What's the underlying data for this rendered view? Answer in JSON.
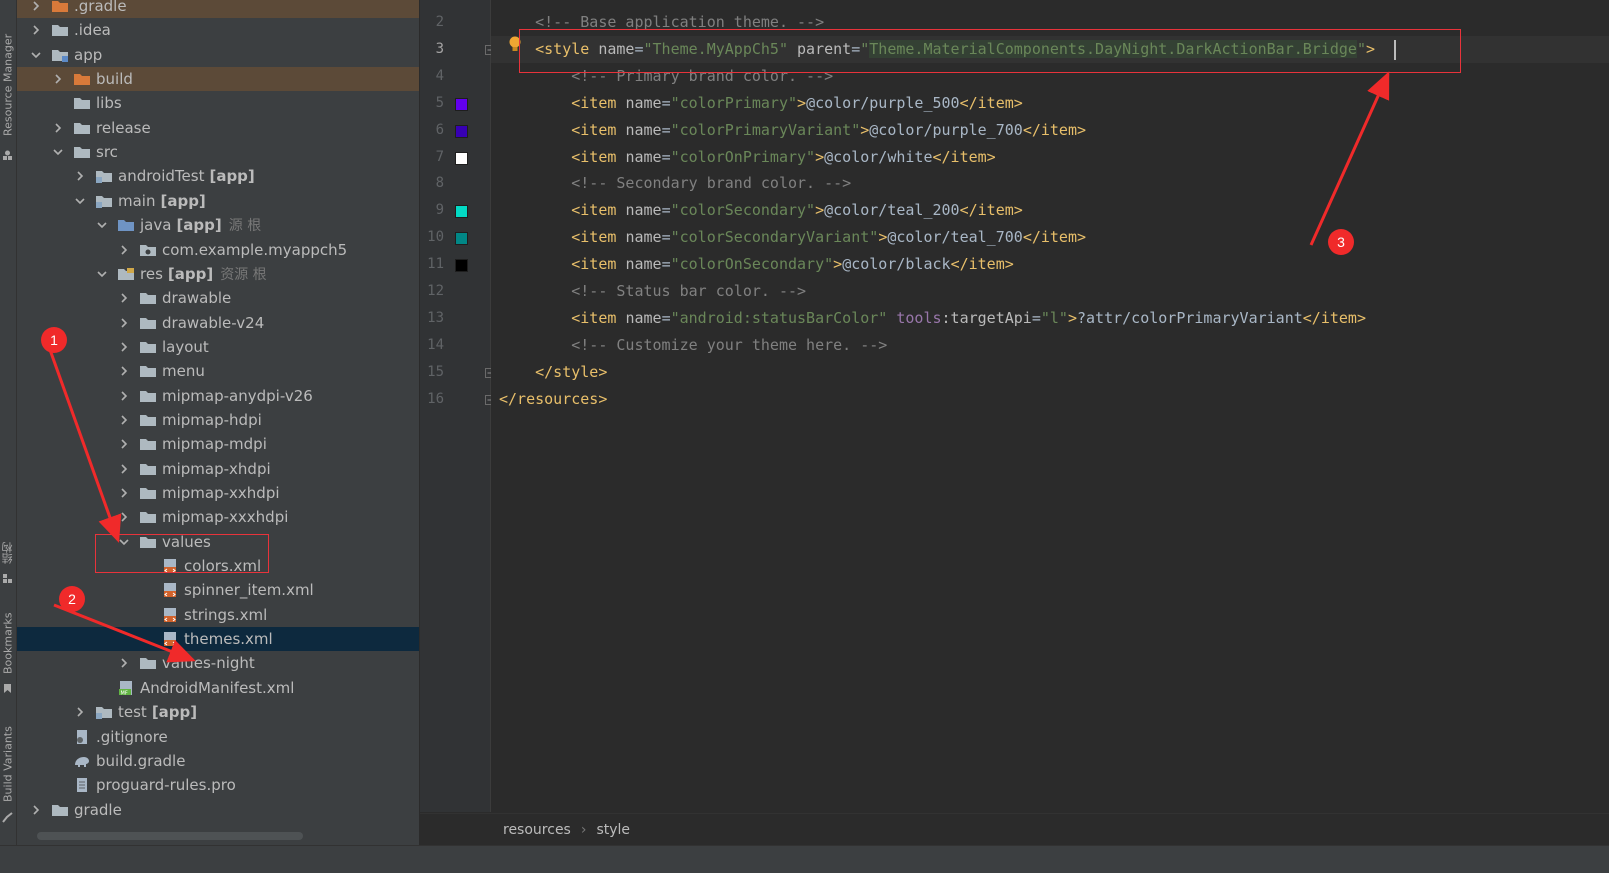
{
  "toolstrip": {
    "resource_manager": "Resource Manager",
    "structure": "结构",
    "bookmarks": "Bookmarks",
    "build_variants": "Build Variants"
  },
  "tree": [
    {
      "label": ".gradle",
      "suffix": "",
      "hint": "",
      "icon": "folder-orange-icon",
      "chevron": "right"
    },
    {
      "label": ".idea",
      "suffix": "",
      "hint": "",
      "icon": "folder-icon",
      "chevron": "right"
    },
    {
      "label": "app",
      "suffix": "",
      "hint": "",
      "icon": "module-folder-icon",
      "chevron": "down"
    },
    {
      "label": "build",
      "suffix": "",
      "hint": "",
      "icon": "folder-orange-icon",
      "chevron": "right"
    },
    {
      "label": "libs",
      "suffix": "",
      "hint": "",
      "icon": "folder-icon",
      "chevron": "none"
    },
    {
      "label": "release",
      "suffix": "",
      "hint": "",
      "icon": "folder-icon",
      "chevron": "right"
    },
    {
      "label": "src",
      "suffix": "",
      "hint": "",
      "icon": "folder-icon",
      "chevron": "down"
    },
    {
      "label": "androidTest",
      "suffix": "[app]",
      "hint": "",
      "icon": "source-folder-icon",
      "chevron": "right"
    },
    {
      "label": "main",
      "suffix": "[app]",
      "hint": "",
      "icon": "source-folder-icon",
      "chevron": "down"
    },
    {
      "label": "java",
      "suffix": "[app]",
      "hint": "源 根",
      "icon": "java-folder-icon",
      "chevron": "down"
    },
    {
      "label": "com.example.myappch5",
      "suffix": "",
      "hint": "",
      "icon": "package-icon",
      "chevron": "right"
    },
    {
      "label": "res",
      "suffix": "[app]",
      "hint": "资源 根",
      "icon": "res-folder-icon",
      "chevron": "down"
    },
    {
      "label": "drawable",
      "suffix": "",
      "hint": "",
      "icon": "folder-icon",
      "chevron": "right"
    },
    {
      "label": "drawable-v24",
      "suffix": "",
      "hint": "",
      "icon": "folder-icon",
      "chevron": "right"
    },
    {
      "label": "layout",
      "suffix": "",
      "hint": "",
      "icon": "folder-icon",
      "chevron": "right"
    },
    {
      "label": "menu",
      "suffix": "",
      "hint": "",
      "icon": "folder-icon",
      "chevron": "right"
    },
    {
      "label": "mipmap-anydpi-v26",
      "suffix": "",
      "hint": "",
      "icon": "folder-icon",
      "chevron": "right"
    },
    {
      "label": "mipmap-hdpi",
      "suffix": "",
      "hint": "",
      "icon": "folder-icon",
      "chevron": "right"
    },
    {
      "label": "mipmap-mdpi",
      "suffix": "",
      "hint": "",
      "icon": "folder-icon",
      "chevron": "right"
    },
    {
      "label": "mipmap-xhdpi",
      "suffix": "",
      "hint": "",
      "icon": "folder-icon",
      "chevron": "right"
    },
    {
      "label": "mipmap-xxhdpi",
      "suffix": "",
      "hint": "",
      "icon": "folder-icon",
      "chevron": "right"
    },
    {
      "label": "mipmap-xxxhdpi",
      "suffix": "",
      "hint": "",
      "icon": "folder-icon",
      "chevron": "right"
    },
    {
      "label": "values",
      "suffix": "",
      "hint": "",
      "icon": "folder-icon",
      "chevron": "down"
    },
    {
      "label": "colors.xml",
      "suffix": "",
      "hint": "",
      "icon": "xml-file-icon",
      "chevron": "none"
    },
    {
      "label": "spinner_item.xml",
      "suffix": "",
      "hint": "",
      "icon": "xml-file-icon",
      "chevron": "none"
    },
    {
      "label": "strings.xml",
      "suffix": "",
      "hint": "",
      "icon": "xml-file-icon",
      "chevron": "none"
    },
    {
      "label": "themes.xml",
      "suffix": "",
      "hint": "",
      "icon": "xml-file-icon",
      "chevron": "none"
    },
    {
      "label": "values-night",
      "suffix": "",
      "hint": "",
      "icon": "folder-icon",
      "chevron": "right"
    },
    {
      "label": "AndroidManifest.xml",
      "suffix": "",
      "hint": "",
      "icon": "manifest-file-icon",
      "chevron": "none"
    },
    {
      "label": "test",
      "suffix": "[app]",
      "hint": "",
      "icon": "source-folder-icon",
      "chevron": "right"
    },
    {
      "label": ".gitignore",
      "suffix": "",
      "hint": "",
      "icon": "gitignore-file-icon",
      "chevron": "none"
    },
    {
      "label": "build.gradle",
      "suffix": "",
      "hint": "",
      "icon": "gradle-file-icon",
      "chevron": "none"
    },
    {
      "label": "proguard-rules.pro",
      "suffix": "",
      "hint": "",
      "icon": "text-file-icon",
      "chevron": "none"
    },
    {
      "label": "gradle",
      "suffix": "",
      "hint": "",
      "icon": "folder-icon",
      "chevron": "right"
    }
  ],
  "editor": {
    "line_numbers": [
      "2",
      "3",
      "4",
      "5",
      "6",
      "7",
      "8",
      "9",
      "10",
      "11",
      "12",
      "13",
      "14",
      "15",
      "16"
    ],
    "color_swatches": [
      "#6200ee",
      "#3700b3",
      "#ffffff",
      "#03dac5",
      "#018786",
      "#000000"
    ],
    "lines": [
      [
        [
          "cm",
          "    <!-- Base application theme. -->"
        ]
      ],
      [
        [
          "pln",
          "    "
        ],
        [
          "tg",
          "<style "
        ],
        [
          "at",
          "name"
        ],
        [
          "pln",
          "="
        ],
        [
          "vl",
          "\"Theme.MyAppCh5\""
        ],
        [
          "pln",
          " "
        ],
        [
          "at",
          "parent"
        ],
        [
          "pln",
          "="
        ],
        [
          "vl",
          "\""
        ],
        [
          "vl hlv",
          "Theme.MaterialComponents.DayNight.DarkActionBar.Bridge"
        ],
        [
          "vl",
          "\""
        ],
        [
          "tg",
          ">"
        ]
      ],
      [
        [
          "cm",
          "        <!-- Primary brand color. -->"
        ]
      ],
      [
        [
          "pln",
          "        "
        ],
        [
          "tg",
          "<item "
        ],
        [
          "at",
          "name"
        ],
        [
          "pln",
          "="
        ],
        [
          "vl",
          "\"colorPrimary\""
        ],
        [
          "tg",
          ">"
        ],
        [
          "pln",
          "@color/purple_500"
        ],
        [
          "tg",
          "</item>"
        ]
      ],
      [
        [
          "pln",
          "        "
        ],
        [
          "tg",
          "<item "
        ],
        [
          "at",
          "name"
        ],
        [
          "pln",
          "="
        ],
        [
          "vl",
          "\"colorPrimaryVariant\""
        ],
        [
          "tg",
          ">"
        ],
        [
          "pln",
          "@color/purple_700"
        ],
        [
          "tg",
          "</item>"
        ]
      ],
      [
        [
          "pln",
          "        "
        ],
        [
          "tg",
          "<item "
        ],
        [
          "at",
          "name"
        ],
        [
          "pln",
          "="
        ],
        [
          "vl",
          "\"colorOnPrimary\""
        ],
        [
          "tg",
          ">"
        ],
        [
          "pln",
          "@color/white"
        ],
        [
          "tg",
          "</item>"
        ]
      ],
      [
        [
          "cm",
          "        <!-- Secondary brand color. -->"
        ]
      ],
      [
        [
          "pln",
          "        "
        ],
        [
          "tg",
          "<item "
        ],
        [
          "at",
          "name"
        ],
        [
          "pln",
          "="
        ],
        [
          "vl",
          "\"colorSecondary\""
        ],
        [
          "tg",
          ">"
        ],
        [
          "pln",
          "@color/teal_200"
        ],
        [
          "tg",
          "</item>"
        ]
      ],
      [
        [
          "pln",
          "        "
        ],
        [
          "tg",
          "<item "
        ],
        [
          "at",
          "name"
        ],
        [
          "pln",
          "="
        ],
        [
          "vl",
          "\"colorSecondaryVariant\""
        ],
        [
          "tg",
          ">"
        ],
        [
          "pln",
          "@color/teal_700"
        ],
        [
          "tg",
          "</item>"
        ]
      ],
      [
        [
          "pln",
          "        "
        ],
        [
          "tg",
          "<item "
        ],
        [
          "at",
          "name"
        ],
        [
          "pln",
          "="
        ],
        [
          "vl",
          "\"colorOnSecondary\""
        ],
        [
          "tg",
          ">"
        ],
        [
          "pln",
          "@color/black"
        ],
        [
          "tg",
          "</item>"
        ]
      ],
      [
        [
          "cm",
          "        <!-- Status bar color. -->"
        ]
      ],
      [
        [
          "pln",
          "        "
        ],
        [
          "tg",
          "<item "
        ],
        [
          "at",
          "name"
        ],
        [
          "pln",
          "="
        ],
        [
          "vl",
          "\"android:statusBarColor\""
        ],
        [
          "pln",
          " "
        ],
        [
          "ns",
          "tools"
        ],
        [
          "at",
          ":targetApi"
        ],
        [
          "pln",
          "="
        ],
        [
          "vl",
          "\"l\""
        ],
        [
          "tg",
          ">"
        ],
        [
          "pln",
          "?attr/colorPrimaryVariant"
        ],
        [
          "tg",
          "</item>"
        ]
      ],
      [
        [
          "cm",
          "        <!-- Customize your theme here. -->"
        ]
      ],
      [
        [
          "pln",
          "    "
        ],
        [
          "tg",
          "</style>"
        ]
      ],
      [
        [
          "tg",
          "</resources>"
        ]
      ]
    ]
  },
  "breadcrumb": {
    "items": [
      "resources",
      "style"
    ]
  },
  "annotations": {
    "badges": [
      "1",
      "2",
      "3"
    ],
    "color": "#e8333b"
  }
}
